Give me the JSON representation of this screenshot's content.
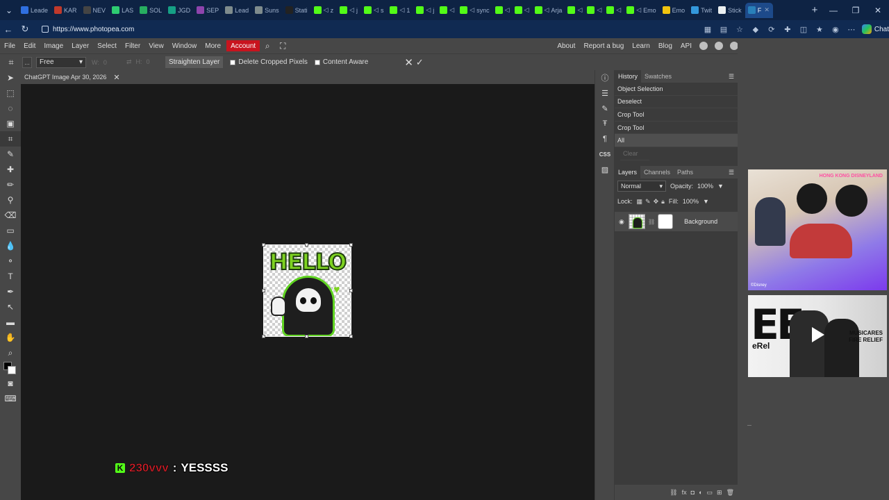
{
  "browser": {
    "tabs": [
      {
        "label": "Leade",
        "active": false,
        "fav": "#2f6fe0",
        "kind": "label"
      },
      {
        "label": "KAR",
        "fav": "#c0392b",
        "kind": "label"
      },
      {
        "label": "NEV",
        "fav": "#444",
        "kind": "label"
      },
      {
        "label": "LAS",
        "fav": "#2ecc71",
        "kind": "label"
      },
      {
        "label": "SOL",
        "fav": "#27ae60",
        "kind": "label"
      },
      {
        "label": "JGD",
        "fav": "#16a085",
        "kind": "label"
      },
      {
        "label": "SEP",
        "fav": "#8e44ad",
        "kind": "label"
      },
      {
        "label": "Lead",
        "fav": "#7f8c8d",
        "kind": "label"
      },
      {
        "label": "Suns",
        "fav": "#7f8c8d",
        "kind": "label"
      },
      {
        "label": "Stati",
        "fav": "#222",
        "kind": "label"
      },
      {
        "label": "z",
        "fav": "k",
        "kind": "kick"
      },
      {
        "label": "j",
        "fav": "k",
        "kind": "kick"
      },
      {
        "label": "s",
        "fav": "k",
        "kind": "kick"
      },
      {
        "label": "1",
        "fav": "k",
        "kind": "kick"
      },
      {
        "label": "j",
        "fav": "k",
        "kind": "kick"
      },
      {
        "label": "",
        "fav": "k",
        "kind": "kick"
      },
      {
        "label": "sync",
        "fav": "k",
        "kind": "kick"
      },
      {
        "label": "",
        "fav": "k",
        "kind": "kick"
      },
      {
        "label": "",
        "fav": "k",
        "kind": "kick"
      },
      {
        "label": "Arja",
        "fav": "k",
        "kind": "kick"
      },
      {
        "label": "",
        "fav": "k",
        "kind": "kick"
      },
      {
        "label": "",
        "fav": "k",
        "kind": "kick"
      },
      {
        "label": "",
        "fav": "k",
        "kind": "kick"
      },
      {
        "label": "Emo",
        "fav": "k",
        "kind": "kick"
      },
      {
        "label": "Emo",
        "fav": "#f1c40f",
        "kind": "label"
      },
      {
        "label": "Twit",
        "fav": "#3498db",
        "kind": "label"
      },
      {
        "label": "Stick",
        "fav": "#ecf0f1",
        "kind": "label"
      },
      {
        "label": "F",
        "fav": "#2980b9",
        "kind": "label",
        "active": true
      }
    ],
    "url": "https://www.photopea.com",
    "copilot_label": "Chat"
  },
  "photopea": {
    "menu": [
      "File",
      "Edit",
      "Image",
      "Layer",
      "Select",
      "Filter",
      "View",
      "Window",
      "More"
    ],
    "account_label": "Account",
    "right_menu": [
      "About",
      "Report a bug",
      "Learn",
      "Blog",
      "API"
    ],
    "options": {
      "dots": "...",
      "ratio": "Free",
      "w_label": "W:",
      "w_value": "0",
      "h_label": "H:",
      "h_value": "0",
      "straighten": "Straighten Layer",
      "delete_cropped": "Delete Cropped Pixels",
      "content_aware": "Content Aware"
    },
    "doc_tab": "ChatGPT Image Apr 30, 2026",
    "sticker_text": "HELLO",
    "history_tabs": {
      "history": "History",
      "swatches": "Swatches"
    },
    "history": [
      {
        "label": "Object Selection",
        "state": "normal"
      },
      {
        "label": "Deselect",
        "state": "normal"
      },
      {
        "label": "Crop Tool",
        "state": "normal"
      },
      {
        "label": "Crop Tool",
        "state": "normal"
      },
      {
        "label": "All",
        "state": "current"
      },
      {
        "label": "Clear",
        "state": "dim"
      }
    ],
    "layer_tabs": {
      "layers": "Layers",
      "channels": "Channels",
      "paths": "Paths"
    },
    "blend_mode": "Normal",
    "opacity_label": "Opacity:",
    "opacity": "100%",
    "lock_label": "Lock:",
    "fill_label": "Fill:",
    "fill": "100%",
    "layer_name": "Background"
  },
  "chat_overlay": {
    "user": "230vvv",
    "separator": ":",
    "message": "YESSSS"
  },
  "ads": {
    "ad1_badge": "HONG KONG DISNEYLAND",
    "ad1_copyright": "©Disney",
    "ad2_big": "EE",
    "ad2_brand_line1": "MUSICARES",
    "ad2_brand_line2": "FIRE RELIEF",
    "ad2_tag": "eRel"
  }
}
